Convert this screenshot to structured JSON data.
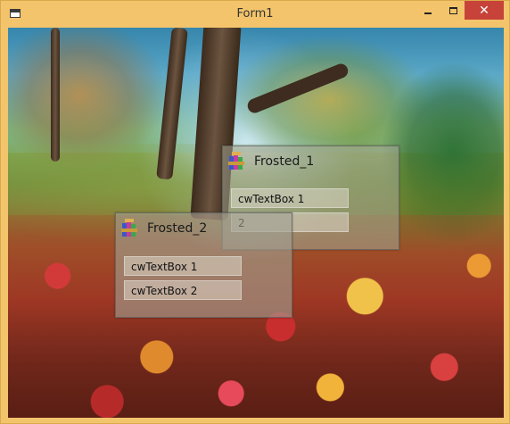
{
  "window": {
    "title": "Form1",
    "close_glyph": "✕"
  },
  "frosted_1": {
    "title": "Frosted_1",
    "textboxes": [
      "cwTextBox 1",
      "2"
    ]
  },
  "frosted_2": {
    "title": "Frosted_2",
    "textboxes": [
      "cwTextBox 1",
      "cwTextBox 2"
    ]
  },
  "icons": {
    "window_icon": "app-window-icon",
    "frosted_icon": "winrar-books-icon"
  },
  "colors": {
    "title_bar": "#f3c46b",
    "close_button": "#c7433a"
  }
}
